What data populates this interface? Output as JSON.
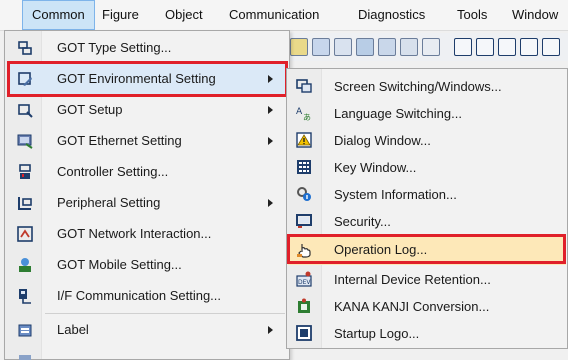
{
  "menubar": {
    "items": [
      "Common",
      "Figure",
      "Object",
      "Communication",
      "Diagnostics",
      "Tools",
      "Window"
    ]
  },
  "common_menu": {
    "items": [
      {
        "label": "GOT Type Setting...",
        "submenu": false
      },
      {
        "label": "GOT Environmental Setting",
        "submenu": true
      },
      {
        "label": "GOT Setup",
        "submenu": true
      },
      {
        "label": "GOT Ethernet Setting",
        "submenu": true
      },
      {
        "label": "Controller Setting...",
        "submenu": false
      },
      {
        "label": "Peripheral Setting",
        "submenu": true
      },
      {
        "label": "GOT Network Interaction...",
        "submenu": false
      },
      {
        "label": "GOT Mobile Setting...",
        "submenu": false
      },
      {
        "label": "I/F Communication Setting...",
        "submenu": false
      },
      {
        "label": "Label",
        "submenu": true
      }
    ]
  },
  "env_submenu": {
    "items": [
      {
        "label": "Screen Switching/Windows..."
      },
      {
        "label": "Language Switching..."
      },
      {
        "label": "Dialog Window..."
      },
      {
        "label": "Key Window..."
      },
      {
        "label": "System Information..."
      },
      {
        "label": "Security..."
      },
      {
        "label": "Operation Log..."
      },
      {
        "label": "Internal Device Retention..."
      },
      {
        "label": "KANA KANJI Conversion..."
      },
      {
        "label": "Startup Logo..."
      }
    ]
  },
  "colors": {
    "highlight_box": "#e0202a",
    "menu_hover": "#dbe9f7",
    "submenu_hover": "#fde8b8",
    "menubar_active": "#cce4f7"
  }
}
